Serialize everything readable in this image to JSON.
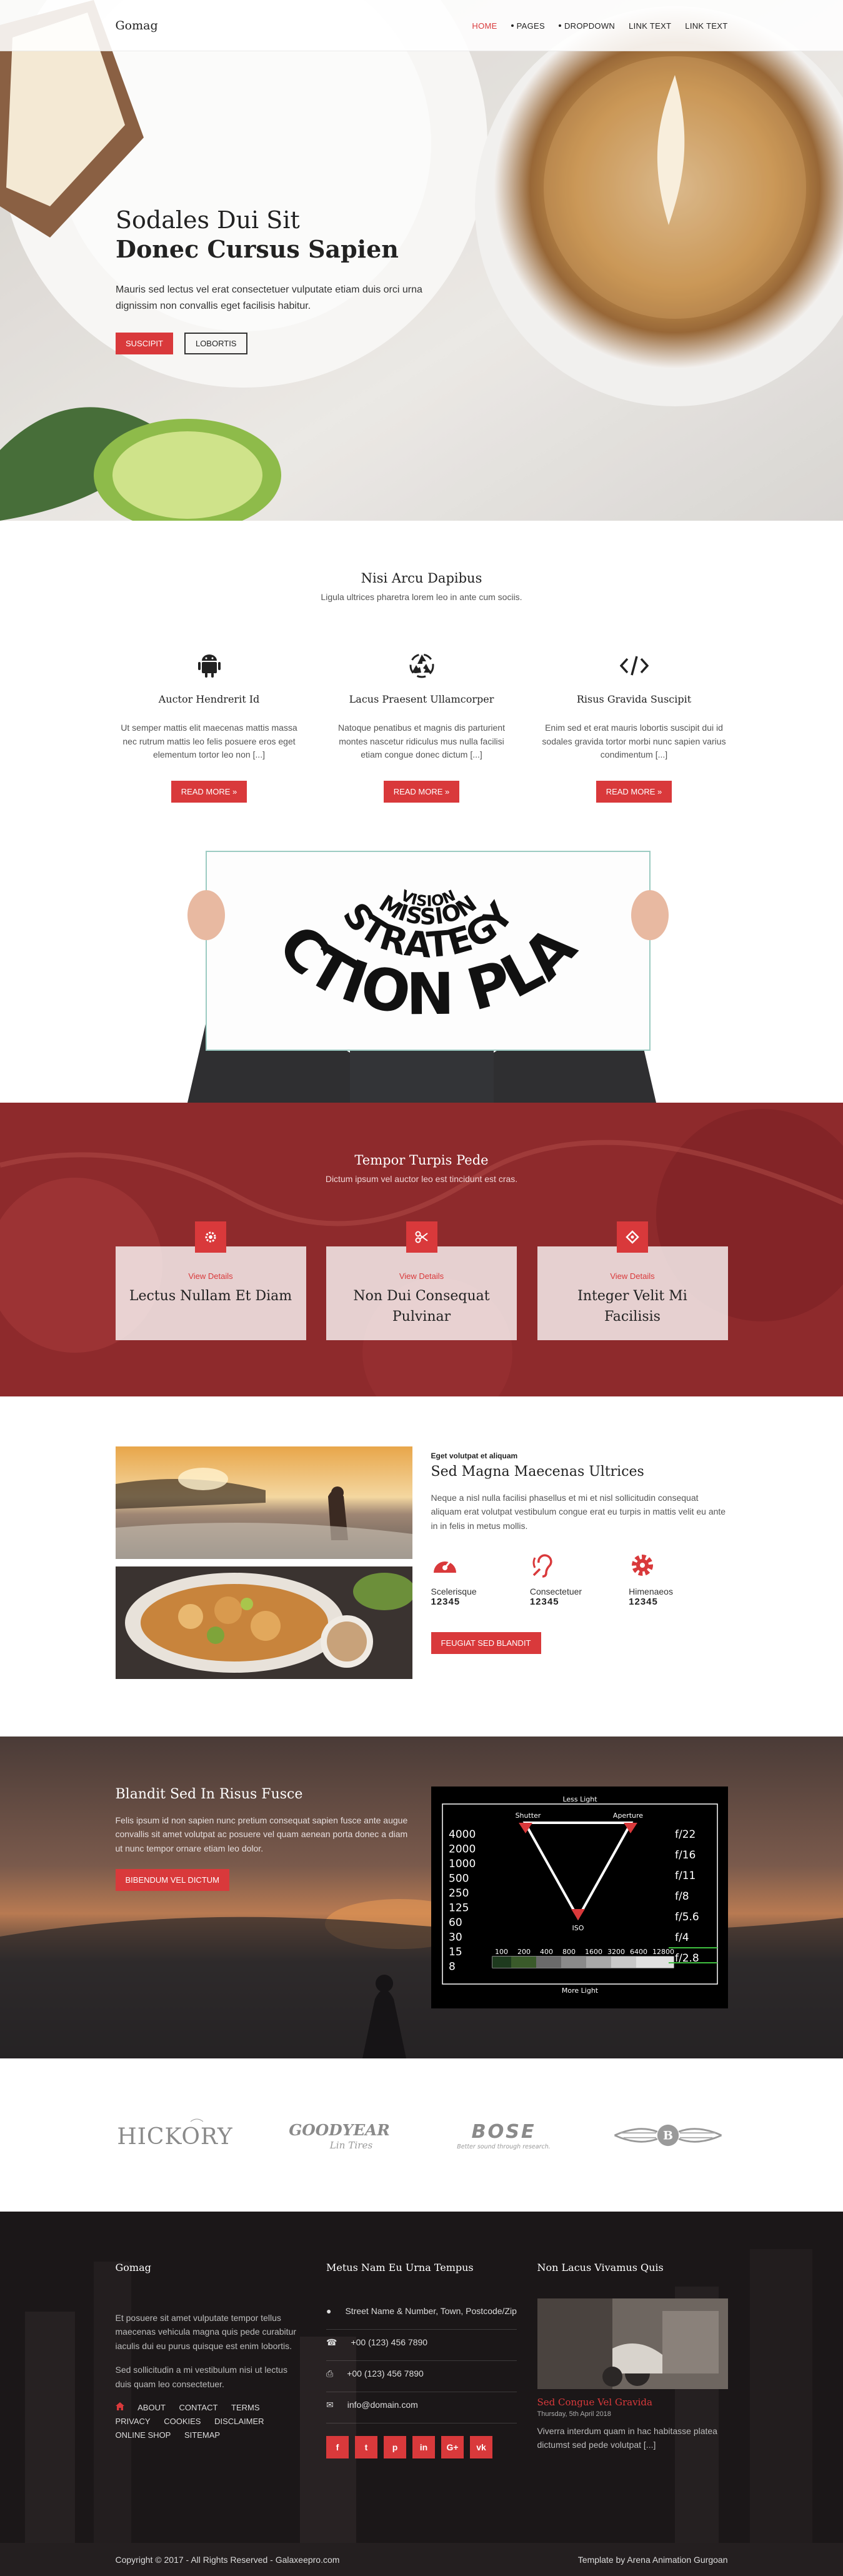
{
  "header": {
    "logo": "Gomag",
    "nav": [
      {
        "label": "HOME",
        "active": true
      },
      {
        "label": "PAGES",
        "dot": true
      },
      {
        "label": "DROPDOWN",
        "dot": true
      },
      {
        "label": "LINK TEXT"
      },
      {
        "label": "LINK TEXT"
      }
    ]
  },
  "hero": {
    "title_line1": "Sodales Dui Sit",
    "title_line2": "Donec Cursus Sapien",
    "text": "Mauris sed lectus vel erat consectetuer vulputate etiam duis orci urna dignissim non convallis eget facilisis habitur.",
    "btn_primary": "SUSCIPIT",
    "btn_secondary": "LOBORTIS"
  },
  "services": {
    "title": "Nisi Arcu Dapibus",
    "subtitle": "Ligula ultrices pharetra lorem leo in ante cum sociis.",
    "items": [
      {
        "icon": "android-icon",
        "title": "Auctor Hendrerit Id",
        "text": "Ut semper mattis elit maecenas mattis massa nec rutrum mattis leo felis posuere eros eget elementum tortor leo non [...]",
        "button": "READ MORE »"
      },
      {
        "icon": "recycle-icon",
        "title": "Lacus Praesent Ullamcorper",
        "text": "Natoque penatibus et magnis dis parturient montes nascetur ridiculus mus nulla facilisi etiam congue donec dictum [...]",
        "button": "READ MORE »"
      },
      {
        "icon": "code-icon",
        "title": "Risus Gravida Suscipit",
        "text": "Enim sed et erat mauris lobortis suscipit dui id sodales gravida tortor morbi nunc sapien varius condimentum [...]",
        "button": "READ MORE »"
      }
    ]
  },
  "action_plan": {
    "words": [
      "VISION",
      "MISSION",
      "STRATEGY",
      "ACTION PLAN"
    ]
  },
  "features": {
    "title": "Tempor Turpis Pede",
    "subtitle": "Dictum ipsum vel auctor leo est tincidunt est cras.",
    "boxes": [
      {
        "icon": "gear-icon",
        "link": "View Details",
        "title": "Lectus Nullam Et Diam"
      },
      {
        "icon": "scissors-icon",
        "link": "View Details",
        "title": "Non Dui Consequat Pulvinar"
      },
      {
        "icon": "diamond-icon",
        "link": "View Details",
        "title": "Integer Velit Mi Facilisis"
      }
    ]
  },
  "about": {
    "kicker": "Eget volutpat et aliquam",
    "title": "Sed Magna Maecenas Ultrices",
    "text": "Neque a nisl nulla facilisi phasellus et mi et nisl sollicitudin consequat aliquam erat volutpat vestibulum congue erat eu turpis in mattis velit eu ante in in felis in metus mollis.",
    "stats": [
      {
        "icon": "dashboard-icon",
        "label": "Scelerisque",
        "value": "12345"
      },
      {
        "icon": "hearing-icon",
        "label": "Consectetuer",
        "value": "12345"
      },
      {
        "icon": "cog-icon",
        "label": "Himenaeos",
        "value": "12345"
      }
    ],
    "button": "FEUGIAT SED BLANDIT"
  },
  "dusk": {
    "title": "Blandit Sed In Risus Fusce",
    "text": "Felis ipsum id non sapien nunc pretium consequat sapien fusce ante augue convallis sit amet volutpat ac posuere vel quam aenean porta donec a diam ut nunc tempor ornare etiam leo dolor.",
    "button": "BIBENDUM VEL DICTUM",
    "camera": {
      "top_label": "Less Light",
      "bottom_label": "More Light",
      "shutter": "Shutter",
      "aperture": "Aperture",
      "iso": "ISO",
      "left_values": [
        "4000",
        "2000",
        "1000",
        "500",
        "250",
        "125",
        "60",
        "30",
        "15",
        "8"
      ],
      "right_values": [
        "f/22",
        "f/16",
        "f/11",
        "f/8",
        "f/5.6",
        "f/4",
        "f/2.8"
      ],
      "iso_values": [
        "100",
        "200",
        "400",
        "800",
        "1600",
        "3200",
        "6400",
        "12800"
      ]
    }
  },
  "brands": [
    "HICKORY",
    "GOODYEAR",
    "BOSE",
    "BENTLEY"
  ],
  "brand_taglines": {
    "goodyear": "Lin Tires",
    "bose": "Better sound through research."
  },
  "footer": {
    "col1": {
      "title": "Gomag",
      "p1": "Et posuere sit amet vulputate tempor tellus maecenas vehicula magna quis pede curabitur iaculis dui eu purus quisque est enim lobortis.",
      "p2": "Sed sollicitudin a mi vestibulum nisi ut lectus duis quam leo consectetuer.",
      "links": [
        "ABOUT",
        "CONTACT",
        "TERMS",
        "PRIVACY",
        "COOKIES",
        "DISCLAIMER",
        "ONLINE SHOP",
        "SITEMAP"
      ]
    },
    "col2": {
      "title": "Metus Nam Eu Urna Tempus",
      "address": "Street Name & Number, Town, Postcode/Zip",
      "phone": "+00 (123) 456 7890",
      "fax": "+00 (123) 456 7890",
      "email": "info@domain.com",
      "social": [
        "f",
        "t",
        "p",
        "in",
        "G+",
        "vk"
      ]
    },
    "col3": {
      "title": "Non Lacus Vivamus Quis",
      "news_title": "Sed Congue Vel Gravida",
      "news_date": "Thursday, 5th April 2018",
      "news_text": "Viverra interdum quam in hac habitasse platea dictumst sed pede volutpat [...]"
    }
  },
  "copyright": {
    "left": "Copyright © 2017 - All Rights Reserved - Galaxeepro.com",
    "right": "Template by Arena Animation Gurgoan"
  },
  "colors": {
    "accent": "#d9393b",
    "red_section": "#8e2a2c",
    "footer": "#1b1718"
  }
}
